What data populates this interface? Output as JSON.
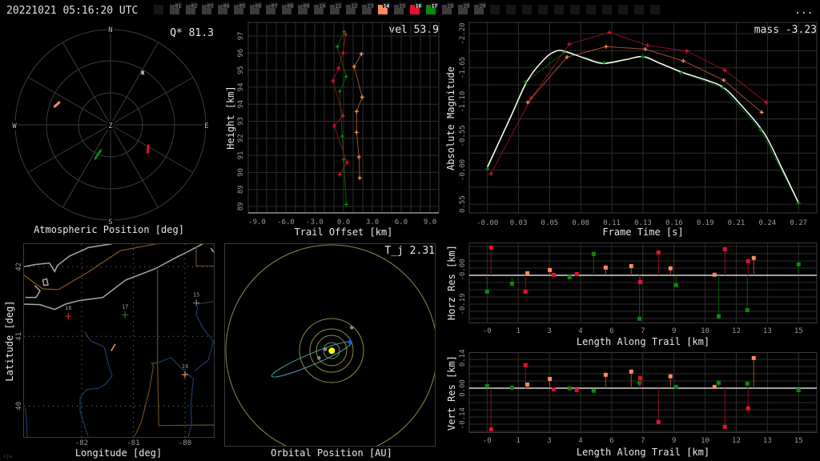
{
  "header": {
    "timestamp": "20221021 05:16:20 UTC",
    "menu_label": "...",
    "cameras": [
      {
        "id": "",
        "state": "empty"
      },
      {
        "id": "01",
        "state": "idle"
      },
      {
        "id": "02",
        "state": "idle"
      },
      {
        "id": "03",
        "state": "idle"
      },
      {
        "id": "04",
        "state": "idle"
      },
      {
        "id": "05",
        "state": "idle"
      },
      {
        "id": "06",
        "state": "idle"
      },
      {
        "id": "07",
        "state": "idle"
      },
      {
        "id": "08",
        "state": "idle"
      },
      {
        "id": "09",
        "state": "idle"
      },
      {
        "id": "10",
        "state": "idle"
      },
      {
        "id": "11",
        "state": "idle"
      },
      {
        "id": "12",
        "state": "idle"
      },
      {
        "id": "13",
        "state": "idle"
      },
      {
        "id": "14",
        "state": "orange"
      },
      {
        "id": "15",
        "state": "idle"
      },
      {
        "id": "16",
        "state": "red"
      },
      {
        "id": "17",
        "state": "green"
      },
      {
        "id": "18",
        "state": "idle"
      },
      {
        "id": "19",
        "state": "idle"
      },
      {
        "id": "20",
        "state": "idle"
      },
      {
        "id": "",
        "state": "empty"
      },
      {
        "id": "",
        "state": "empty"
      },
      {
        "id": "",
        "state": "empty"
      },
      {
        "id": "",
        "state": "empty"
      },
      {
        "id": "",
        "state": "empty"
      },
      {
        "id": "",
        "state": "empty"
      },
      {
        "id": "",
        "state": "empty"
      },
      {
        "id": "",
        "state": "empty"
      },
      {
        "id": "",
        "state": "empty"
      },
      {
        "id": "",
        "state": "empty"
      },
      {
        "id": "",
        "state": "empty"
      }
    ]
  },
  "colors": {
    "orange": "#ff8c5a",
    "red": "#e8102e",
    "green": "#0b8a0b",
    "orange_dim": "#a0502f",
    "red_dim": "#8a0f22",
    "green_dim": "#0a5a0a",
    "idle": "#3c3c3c",
    "empty": "#161616",
    "fit": "#ffffff",
    "orbit": "#4aa3b0"
  },
  "atmos": {
    "title": "Atmospheric Position [deg]",
    "stat": "Q* 81.3",
    "cardinals": {
      "N": "N",
      "S": "S",
      "E": "E",
      "W": "W",
      "Z": "Z"
    },
    "radiant": {
      "label": "R",
      "az": 32.9,
      "zen": 56.1
    },
    "tracks": [
      {
        "station": "14",
        "color": "orange",
        "points": [
          [
            288.3,
            55.5
          ],
          [
            293.6,
            52.9
          ]
        ]
      },
      {
        "station": "17",
        "color": "green",
        "points": [
          [
            204.3,
            34.9
          ],
          [
            201.0,
            25.9
          ]
        ]
      },
      {
        "station": "16",
        "color": "red",
        "points": [
          [
            126.5,
            43.6
          ],
          [
            118.8,
            40.8
          ]
        ]
      }
    ]
  },
  "trail": {
    "stat": "vel 53.9",
    "xlabel": "Trail Offset [km]",
    "ylabel": "Height [km]",
    "xticks": [
      {
        "v": -9,
        "label": "-9.0"
      },
      {
        "v": -6,
        "label": "-6.0"
      },
      {
        "v": -3,
        "label": "-3.0"
      },
      {
        "v": 0,
        "label": "0.0"
      },
      {
        "v": 3,
        "label": "3.0"
      },
      {
        "v": 6,
        "label": "6.0"
      },
      {
        "v": 9,
        "label": "9.0"
      }
    ],
    "yticks": [
      {
        "v": 97.0,
        "label": "97"
      },
      {
        "v": 96.2,
        "label": "96"
      },
      {
        "v": 95.4,
        "label": "95"
      },
      {
        "v": 94.6,
        "label": "94"
      },
      {
        "v": 93.8,
        "label": "94"
      },
      {
        "v": 93.0,
        "label": "93"
      },
      {
        "v": 92.2,
        "label": "92"
      },
      {
        "v": 91.4,
        "label": "91"
      },
      {
        "v": 90.6,
        "label": "90"
      },
      {
        "v": 89.8,
        "label": "89"
      },
      {
        "v": 89.0,
        "label": "89"
      }
    ],
    "series": [
      {
        "station": "17",
        "color": "green",
        "points": [
          [
            0.06,
            97.2
          ],
          [
            -0.64,
            96.5
          ],
          [
            0.28,
            95.1
          ],
          [
            -0.39,
            94.4
          ],
          [
            -0.14,
            92.3
          ],
          [
            0.03,
            91.2
          ],
          [
            0.28,
            89.1
          ]
        ]
      },
      {
        "station": "16",
        "color": "red",
        "points": [
          [
            0.22,
            97.06
          ],
          [
            -0.06,
            96.21
          ],
          [
            -0.53,
            95.49
          ],
          [
            -1.11,
            94.89
          ],
          [
            -0.06,
            93.26
          ],
          [
            -0.97,
            92.79
          ],
          [
            0.36,
            91.06
          ],
          [
            -0.39,
            90.5
          ]
        ]
      },
      {
        "station": "14",
        "color": "orange",
        "points": [
          [
            1.86,
            96.16
          ],
          [
            1.11,
            95.56
          ],
          [
            1.94,
            94.13
          ],
          [
            1.36,
            93.46
          ],
          [
            1.36,
            92.48
          ],
          [
            1.61,
            91.32
          ],
          [
            1.69,
            90.34
          ]
        ]
      }
    ]
  },
  "magnitude": {
    "stat": "mass -3.23",
    "xlabel": "Frame Time [s]",
    "ylabel": "Absolute Magnitude",
    "xticks": [
      "-0.00",
      "0.03",
      "0.05",
      "0.08",
      "0.11",
      "0.13",
      "0.16",
      "0.19",
      "0.21",
      "0.24",
      "0.27"
    ],
    "xtick_step": 0.027,
    "yticks": [
      {
        "v": -2.2,
        "label": "-2.20"
      },
      {
        "v": -1.65,
        "label": "-1.65"
      },
      {
        "v": -1.1,
        "label": "-1.10"
      },
      {
        "v": -0.55,
        "label": "-0.55"
      },
      {
        "v": 0.0,
        "label": "-0.00"
      },
      {
        "v": 0.55,
        "label": "0.55"
      }
    ],
    "series": [
      {
        "station": "17",
        "color": "green",
        "points": [
          [
            0,
            -0.02
          ],
          [
            0.033,
            -1.42
          ],
          [
            0.067,
            -1.9
          ],
          [
            0.101,
            -1.73
          ],
          [
            0.135,
            -1.83
          ],
          [
            0.168,
            -1.57
          ],
          [
            0.204,
            -1.33
          ],
          [
            0.237,
            -0.65
          ],
          [
            0.27,
            0.53
          ]
        ]
      },
      {
        "station": "16",
        "color": "red",
        "points": [
          [
            0.003,
            0.06
          ],
          [
            0.038,
            -1.16
          ],
          [
            0.071,
            -2.03
          ],
          [
            0.106,
            -2.22
          ],
          [
            0.139,
            -2.01
          ],
          [
            0.173,
            -1.92
          ],
          [
            0.206,
            -1.61
          ],
          [
            0.242,
            -1.09
          ]
        ]
      },
      {
        "station": "14",
        "color": "orange",
        "points": [
          [
            0.035,
            -1.09
          ],
          [
            0.069,
            -1.82
          ],
          [
            0.103,
            -1.99
          ],
          [
            0.137,
            -1.95
          ],
          [
            0.17,
            -1.76
          ],
          [
            0.205,
            -1.45
          ],
          [
            0.238,
            -0.93
          ]
        ]
      }
    ],
    "fit": [
      [
        0,
        -0.05
      ],
      [
        0.02,
        -0.85
      ],
      [
        0.035,
        -1.45
      ],
      [
        0.05,
        -1.8
      ],
      [
        0.06,
        -1.92
      ],
      [
        0.068,
        -1.91
      ],
      [
        0.085,
        -1.8
      ],
      [
        0.1,
        -1.72
      ],
      [
        0.12,
        -1.78
      ],
      [
        0.135,
        -1.83
      ],
      [
        0.15,
        -1.72
      ],
      [
        0.17,
        -1.57
      ],
      [
        0.19,
        -1.45
      ],
      [
        0.205,
        -1.33
      ],
      [
        0.22,
        -1.05
      ],
      [
        0.24,
        -0.6
      ],
      [
        0.255,
        -0.05
      ],
      [
        0.27,
        0.53
      ]
    ]
  },
  "map": {
    "xlabel": "Longitude [deg]",
    "ylabel": "Latitude [deg]",
    "xticks": [
      {
        "v": -82,
        "label": "-82"
      },
      {
        "v": -81,
        "label": "-81"
      },
      {
        "v": -80,
        "label": "-80"
      }
    ],
    "yticks": [
      {
        "v": 42,
        "label": "42"
      },
      {
        "v": 41,
        "label": "41"
      },
      {
        "v": 40,
        "label": "40"
      }
    ],
    "stations": [
      {
        "id": "16",
        "color": "red",
        "lon": -82.26,
        "lat": 41.29
      },
      {
        "id": "17",
        "color": "green",
        "lon": -81.16,
        "lat": 41.31
      },
      {
        "id": "15",
        "color": "idle",
        "lon": -79.78,
        "lat": 41.48
      },
      {
        "id": "14",
        "color": "orange",
        "lon": -80.0,
        "lat": 40.45
      }
    ],
    "trail": [
      [
        -81.43,
        40.79
      ],
      [
        -81.35,
        40.89
      ]
    ],
    "watermark": "ojw"
  },
  "orbit": {
    "title": "Orbital Position [AU]",
    "stat": "T_j 2.31"
  },
  "residuals": {
    "xlabel": "Length Along Trail [km]",
    "xticks": [
      "-0",
      "1",
      "3",
      "4",
      "6",
      "7",
      "9",
      "10",
      "12",
      "13",
      "15"
    ],
    "xtick_step": 1.5,
    "horizontal": {
      "ylabel": "Horz Res [km]",
      "yticks": [
        "-0.00",
        "-0.19"
      ],
      "series": [
        {
          "station": "17",
          "color": "green",
          "points": [
            [
              0,
              -0.086
            ],
            [
              1.2,
              -0.044
            ],
            [
              3.97,
              -0.01
            ],
            [
              5.13,
              0.113
            ],
            [
              7.34,
              -0.23
            ],
            [
              9.1,
              -0.052
            ],
            [
              11.15,
              -0.217
            ],
            [
              12.53,
              -0.184
            ],
            [
              15.0,
              0.058
            ]
          ]
        },
        {
          "station": "16",
          "color": "red",
          "points": [
            [
              0.19,
              0.147
            ],
            [
              1.85,
              -0.086
            ],
            [
              3.2,
              0.003
            ],
            [
              4.32,
              0.007
            ],
            [
              7.37,
              -0.036
            ],
            [
              8.25,
              0.121
            ],
            [
              11.45,
              0.138
            ],
            [
              12.57,
              0.075
            ]
          ]
        },
        {
          "station": "14",
          "color": "orange",
          "points": [
            [
              1.94,
              0.011
            ],
            [
              3.02,
              0.028
            ],
            [
              5.71,
              0.041
            ],
            [
              6.94,
              0.049
            ],
            [
              8.83,
              0.037
            ],
            [
              10.95,
              0.003
            ],
            [
              12.84,
              0.092
            ]
          ]
        }
      ]
    },
    "vertical": {
      "ylabel": "Vert Res [km]",
      "yticks": [
        {
          "v": 0.14,
          "label": "0.14"
        },
        {
          "v": 0.0,
          "label": "0.00"
        },
        {
          "v": -0.14,
          "label": "-0.14"
        }
      ],
      "series": [
        {
          "station": "17",
          "color": "green",
          "points": [
            [
              0,
              0.01
            ],
            [
              1.2,
              0.002
            ],
            [
              3.97,
              -0.001
            ],
            [
              5.13,
              -0.012
            ],
            [
              7.34,
              0.025
            ],
            [
              9.1,
              0.006
            ],
            [
              11.15,
              0.025
            ],
            [
              12.53,
              0.021
            ],
            [
              15.0,
              -0.009
            ]
          ]
        },
        {
          "station": "16",
          "color": "red",
          "points": [
            [
              0.19,
              -0.191
            ],
            [
              1.85,
              0.107
            ],
            [
              3.2,
              -0.005
            ],
            [
              4.32,
              -0.009
            ],
            [
              7.37,
              0.047
            ],
            [
              8.25,
              -0.157
            ],
            [
              11.45,
              -0.18
            ],
            [
              12.57,
              -0.094
            ]
          ]
        },
        {
          "station": "14",
          "color": "orange",
          "points": [
            [
              1.94,
              0.017
            ],
            [
              3.02,
              0.043
            ],
            [
              5.71,
              0.062
            ],
            [
              6.94,
              0.077
            ],
            [
              8.83,
              0.055
            ],
            [
              10.95,
              0.006
            ],
            [
              12.84,
              0.14
            ]
          ]
        }
      ]
    }
  }
}
